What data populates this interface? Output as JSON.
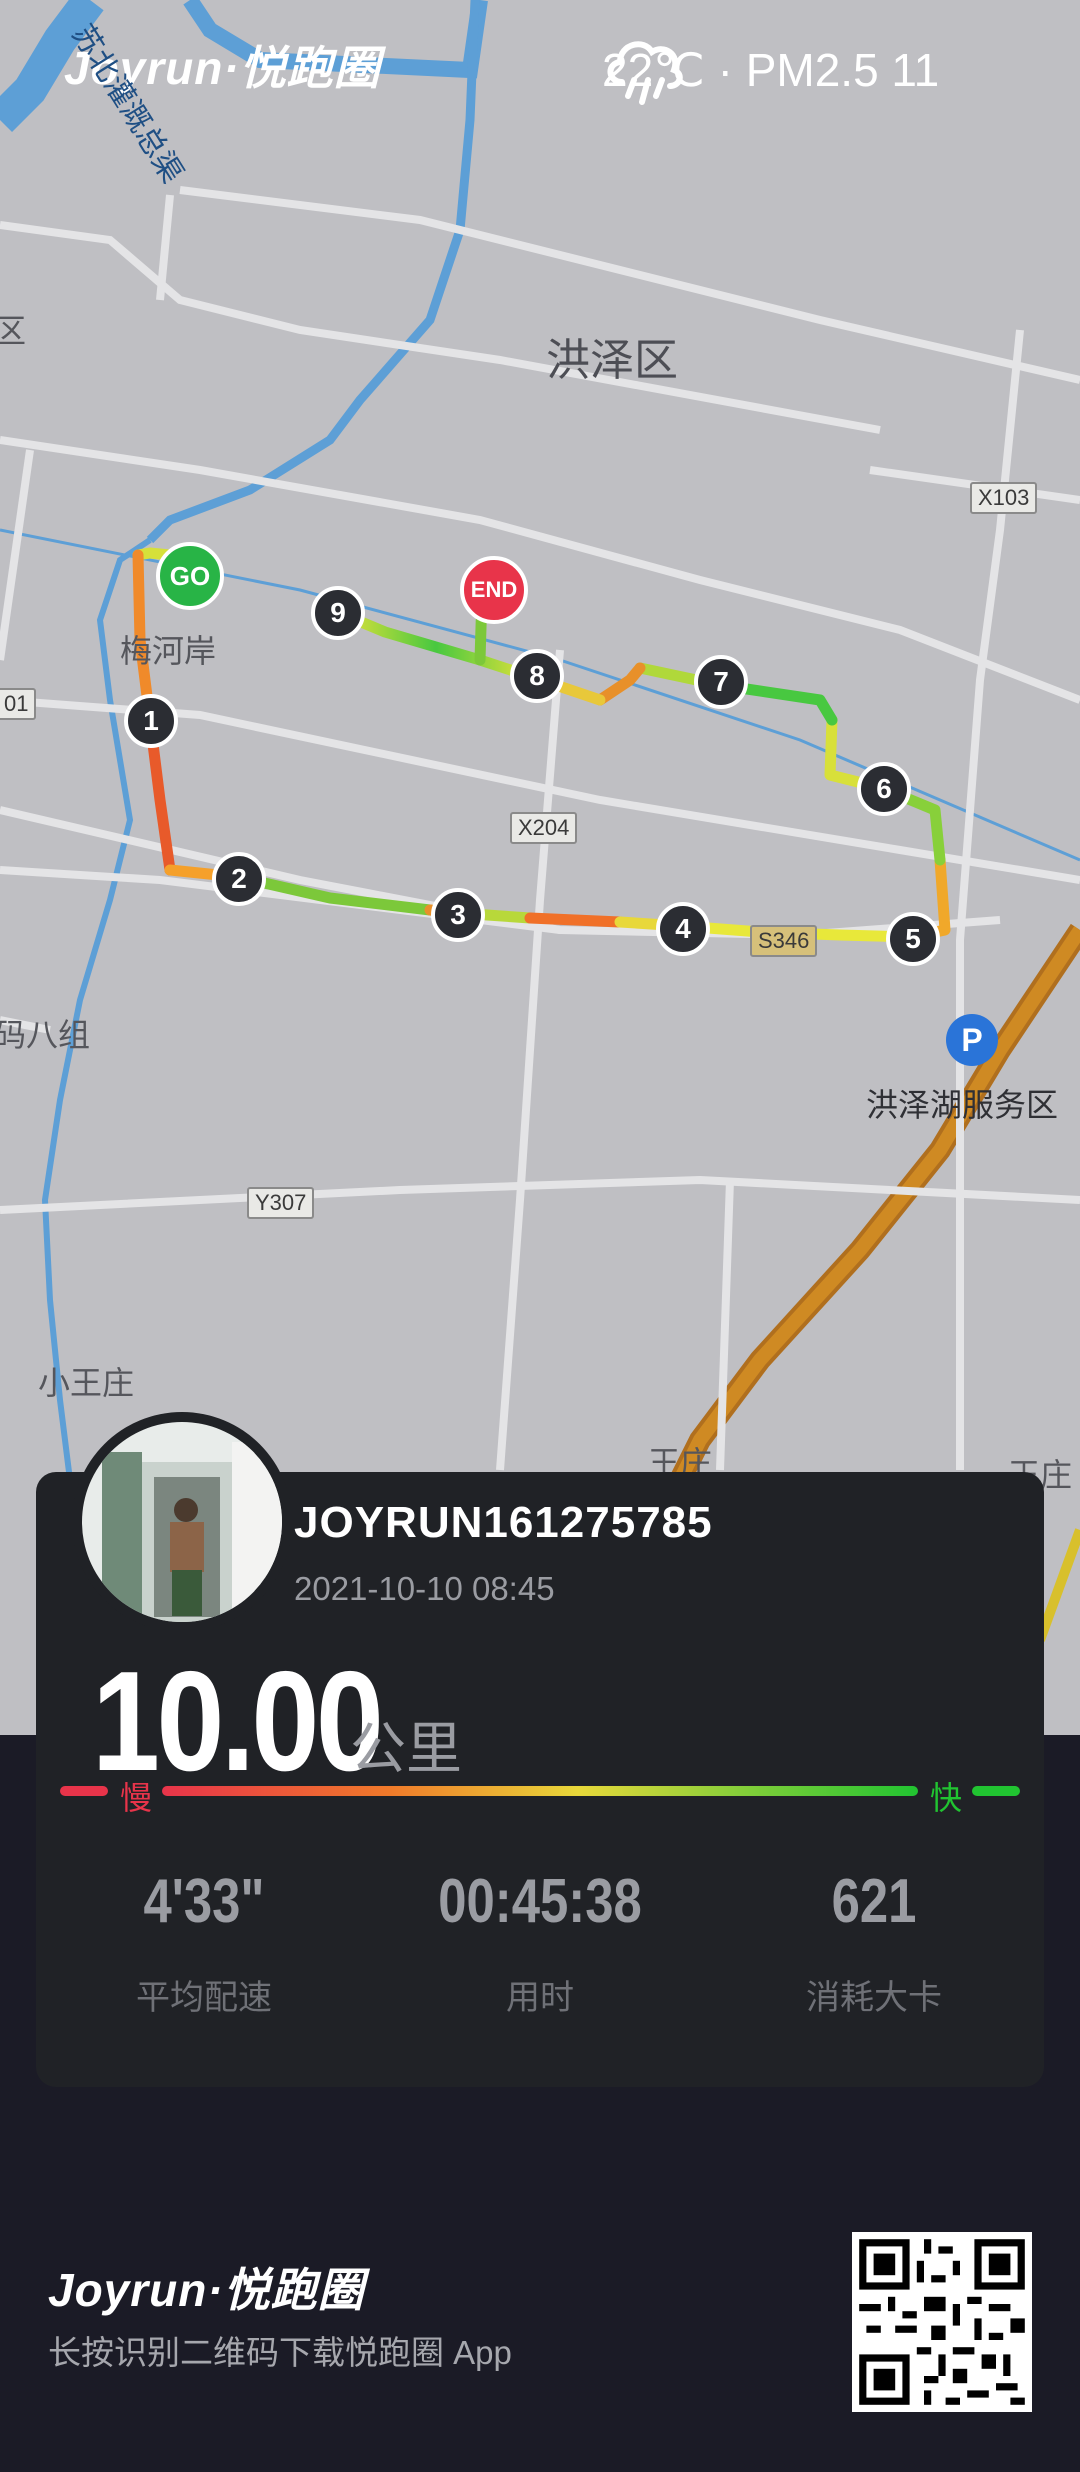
{
  "header": {
    "brand": "Joyrun·悦跑圈",
    "weather_icon": "rain-cloud-icon",
    "weather": "22℃ · PM2.5 11"
  },
  "map": {
    "places": [
      "苏北灌溉总渠",
      "洪泽区",
      "梅河岸",
      "X103",
      "X204",
      "S346",
      "Y307",
      "码八组",
      "洪泽湖服务区",
      "小王庄",
      "王庄",
      "王庄",
      "区",
      "01"
    ],
    "markers": {
      "start": "GO",
      "end": "END",
      "km": [
        "1",
        "2",
        "3",
        "4",
        "5",
        "6",
        "7",
        "8",
        "9"
      ]
    },
    "parking_icon": "parking-icon",
    "parking_label": "P"
  },
  "card": {
    "username": "JOYRUN161275785",
    "datetime": "2021-10-10 08:45",
    "distance": "10.00",
    "unit": "公里",
    "pace_legend": {
      "slow": "慢",
      "fast": "快"
    },
    "stats": [
      {
        "value": "4'33\"",
        "label": "平均配速"
      },
      {
        "value": "00:45:38",
        "label": "用时"
      },
      {
        "value": "621",
        "label": "消耗大卡"
      }
    ]
  },
  "footer": {
    "brand": "Joyrun·悦跑圈",
    "note": "长按识别二维码下载悦跑圈 App"
  },
  "colors": {
    "pace_slow": "#e8344a",
    "pace_fast": "#21c431",
    "card_bg": "#202226",
    "page_bg": "#1b1b26"
  }
}
